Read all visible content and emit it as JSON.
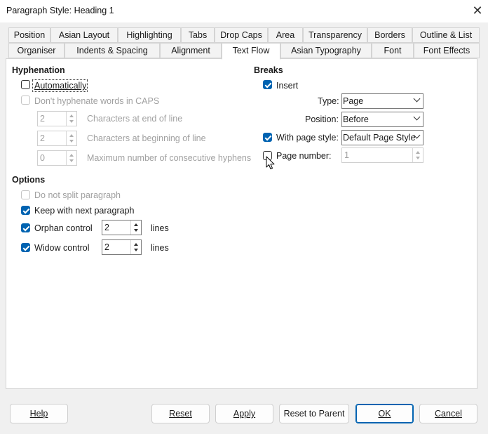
{
  "window": {
    "title": "Paragraph Style: Heading 1",
    "close_symbol": "✕"
  },
  "tabs_row1": [
    "Position",
    "Asian Layout",
    "Highlighting",
    "Tabs",
    "Drop Caps",
    "Area",
    "Transparency",
    "Borders",
    "Outline & List"
  ],
  "tabs_row2": [
    "Organiser",
    "Indents & Spacing",
    "Alignment",
    "Text Flow",
    "Asian Typography",
    "Font",
    "Font Effects"
  ],
  "active_tab": "Text Flow",
  "hyphenation": {
    "title": "Hyphenation",
    "automatically_label": "Automatically",
    "automatically_checked": false,
    "caps_label": "Don't hyphenate words in CAPS",
    "chars_end_value": "2",
    "chars_end_label": "Characters at end of line",
    "chars_begin_value": "2",
    "chars_begin_label": "Characters at beginning of line",
    "max_hyphens_value": "0",
    "max_hyphens_label": "Maximum number of consecutive hyphens"
  },
  "breaks": {
    "title": "Breaks",
    "insert_label": "Insert",
    "insert_checked": true,
    "type_label": "Type:",
    "type_value": "Page",
    "position_label": "Position:",
    "position_value": "Before",
    "with_page_style_label": "With page style:",
    "with_page_style_checked": true,
    "page_style_value": "Default Page Style",
    "page_number_label": "Page number:",
    "page_number_checked": false,
    "page_number_value": "1"
  },
  "options": {
    "title": "Options",
    "do_not_split_label": "Do not split paragraph",
    "keep_with_next_label": "Keep with next paragraph",
    "keep_with_next_checked": true,
    "orphan_label": "Orphan control",
    "orphan_checked": true,
    "orphan_value": "2",
    "widow_label": "Widow control",
    "widow_checked": true,
    "widow_value": "2",
    "lines_label": "lines"
  },
  "buttons": {
    "help": "Help",
    "reset": "Reset",
    "apply": "Apply",
    "reset_to_parent": "Reset to Parent",
    "ok": "OK",
    "cancel": "Cancel"
  },
  "colors": {
    "accent": "#0063b1",
    "disabled_text": "#a0a0a0",
    "dialog_bg": "#f0f0f0"
  }
}
